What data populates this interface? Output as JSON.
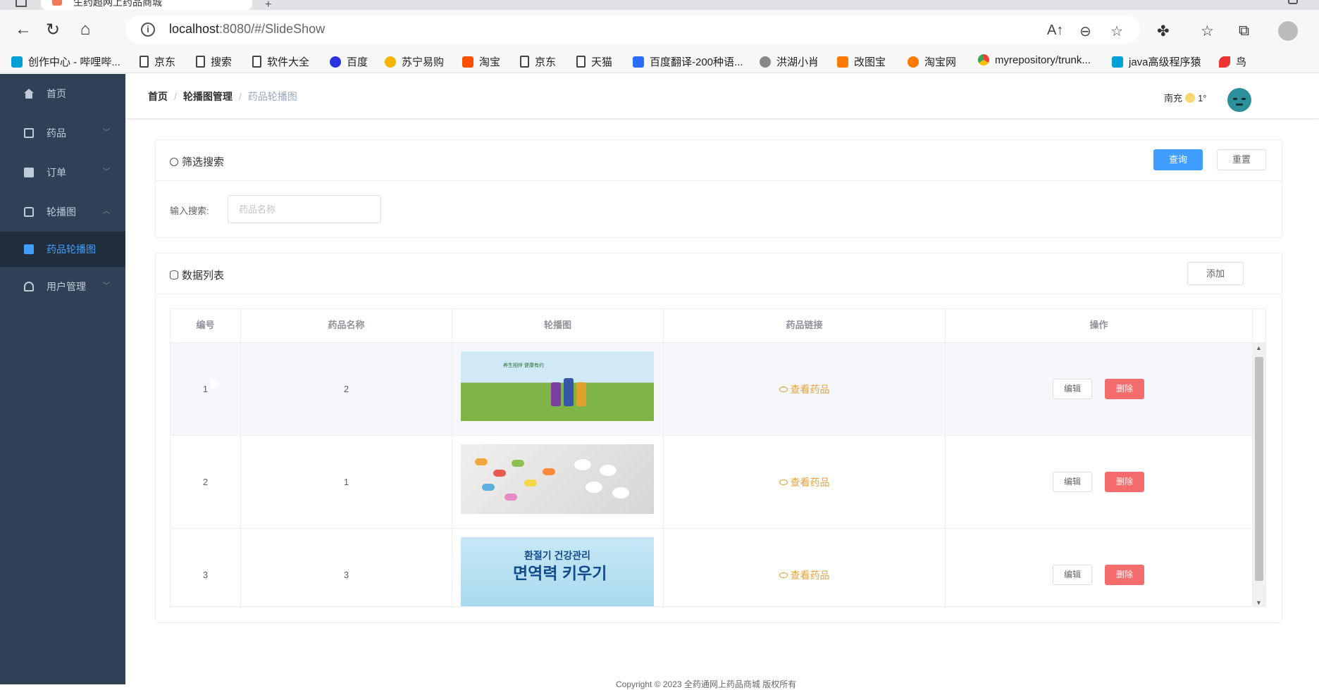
{
  "browser": {
    "tab_title": "生药超网上药品商城",
    "url_host": "localhost",
    "url_rest": ":8080/#/SlideShow",
    "bookmarks": [
      {
        "label": "创作中心 - 哔哩哔...",
        "icon": "bili"
      },
      {
        "label": "京东",
        "icon": "doc"
      },
      {
        "label": "搜索",
        "icon": "doc"
      },
      {
        "label": "软件大全",
        "icon": "doc"
      },
      {
        "label": "百度",
        "icon": "baidu"
      },
      {
        "label": "苏宁易购",
        "icon": "suning"
      },
      {
        "label": "淘宝",
        "icon": "taobao"
      },
      {
        "label": "京东",
        "icon": "doc"
      },
      {
        "label": "天猫",
        "icon": "doc"
      },
      {
        "label": "百度翻译-200种语...",
        "icon": "trans"
      },
      {
        "label": "洪湖小肖",
        "icon": "hh"
      },
      {
        "label": "改图宝",
        "icon": "gt"
      },
      {
        "label": "淘宝网",
        "icon": "tbw"
      },
      {
        "label": "myrepository/trunk...",
        "icon": "chrome"
      },
      {
        "label": "java高级程序猿",
        "icon": "bili"
      },
      {
        "label": "鸟",
        "icon": "bird"
      }
    ]
  },
  "sidebar": {
    "items": [
      {
        "label": "首页",
        "icon": "home-icon",
        "arrow": ""
      },
      {
        "label": "药品",
        "icon": "bag-icon",
        "arrow": "﹀"
      },
      {
        "label": "订单",
        "icon": "clipboard-icon",
        "arrow": "﹀"
      },
      {
        "label": "轮播图",
        "icon": "lock-icon",
        "arrow": "︿"
      },
      {
        "label": "药品轮播图",
        "icon": "picture-icon",
        "arrow": ""
      },
      {
        "label": "用户管理",
        "icon": "bell-icon",
        "arrow": "﹀"
      }
    ]
  },
  "navbar": {
    "breadcrumb": [
      "首页",
      "轮播图管理",
      "药品轮播图"
    ],
    "weather_city": "南充",
    "weather_temp": "1°"
  },
  "filter": {
    "title": "筛选搜索",
    "query_label": "查询",
    "reset_label": "重置",
    "input_label": "输入搜索:",
    "input_placeholder": "药品名称",
    "input_value": ""
  },
  "list": {
    "title": "数据列表",
    "add_label": "添加",
    "columns": [
      "编号",
      "药品名称",
      "轮播图",
      "药品链接",
      "操作"
    ],
    "rows": [
      {
        "id": "1",
        "name": "2",
        "link": "查看药品",
        "edit": "编辑",
        "delete": "删除"
      },
      {
        "id": "2",
        "name": "1",
        "link": "查看药品",
        "edit": "编辑",
        "delete": "删除"
      },
      {
        "id": "3",
        "name": "3",
        "link": "查看药品",
        "edit": "编辑",
        "delete": "删除"
      }
    ],
    "banner3_line1": "환절기 건강관리",
    "banner3_line2": "면역력 키우기",
    "banner1_text": "养生相伴 健康有约"
  },
  "footer": "Copyright © 2023 全药通网上药品商城 版权所有",
  "colors": {
    "sidebar_bg": "#304156",
    "primary": "#409eff",
    "danger": "#f56c6c",
    "warning": "#e6a23c"
  }
}
